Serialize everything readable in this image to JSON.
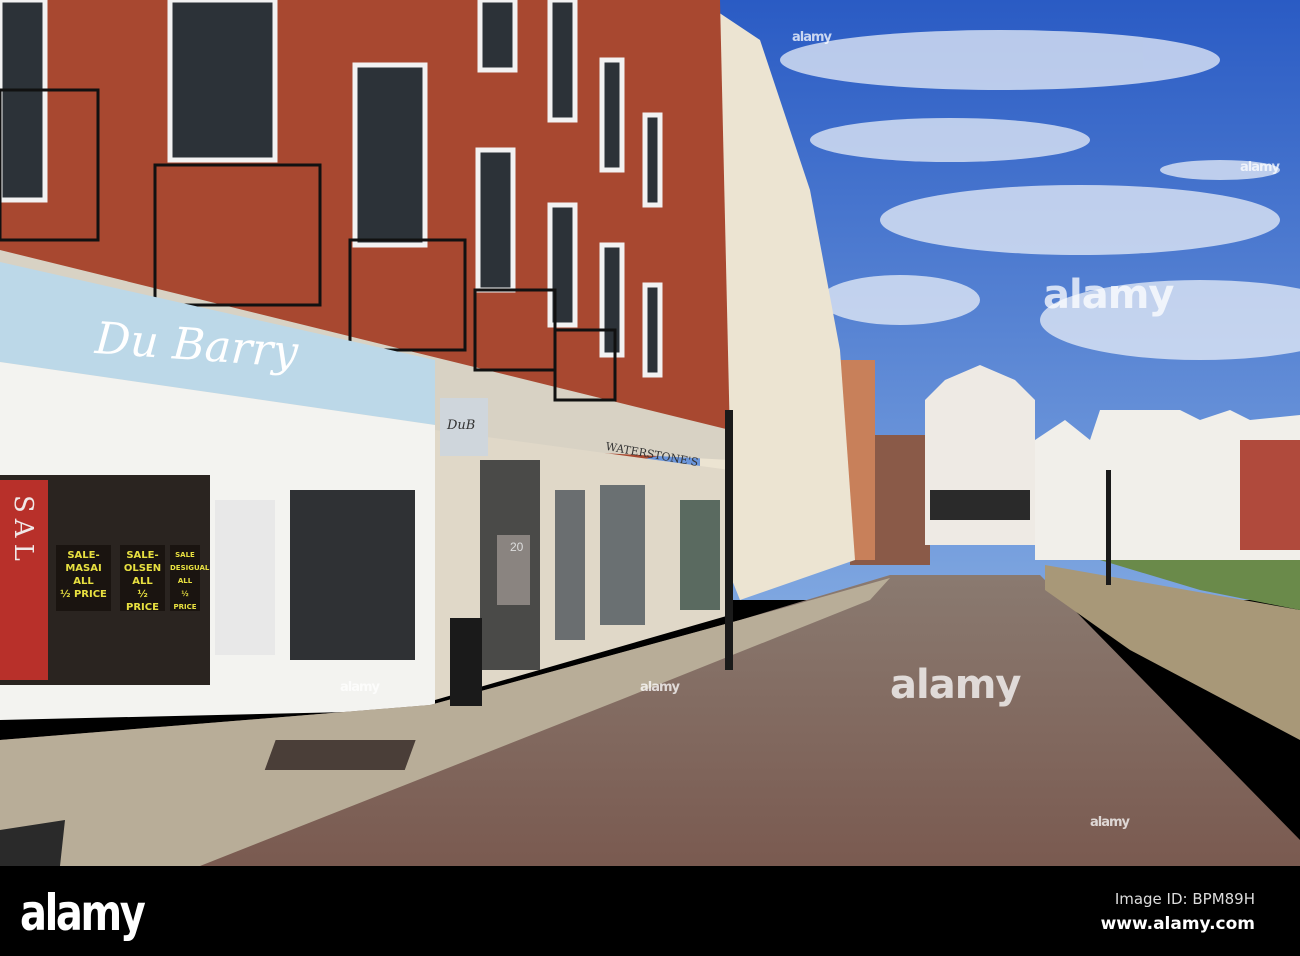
{
  "scene": {
    "shop_sign": "Du Barry",
    "hanging_sign": "DuB",
    "bookshop_sign": "WATERSTONE'S",
    "door_number": "20",
    "window_sale_letters": "SAL",
    "sale_cards": [
      {
        "line1": "SALE-",
        "line2": "MASAI",
        "line3": "ALL",
        "line4": "½ PRICE"
      },
      {
        "line1": "SALE-",
        "line2": "OLSEN",
        "line3": "ALL",
        "line4": "½ PRICE"
      },
      {
        "line1": "SALE",
        "line2": "DESIGUAL",
        "line3": "ALL",
        "line4": "½ PRICE"
      }
    ]
  },
  "watermarks": [
    "alamy",
    "alamy",
    "alamy",
    "alamy",
    "alamy",
    "alamy",
    "alamy"
  ],
  "footer": {
    "logo": "alamy",
    "image_id": "Image ID: BPM89H",
    "website": "www.alamy.com"
  }
}
